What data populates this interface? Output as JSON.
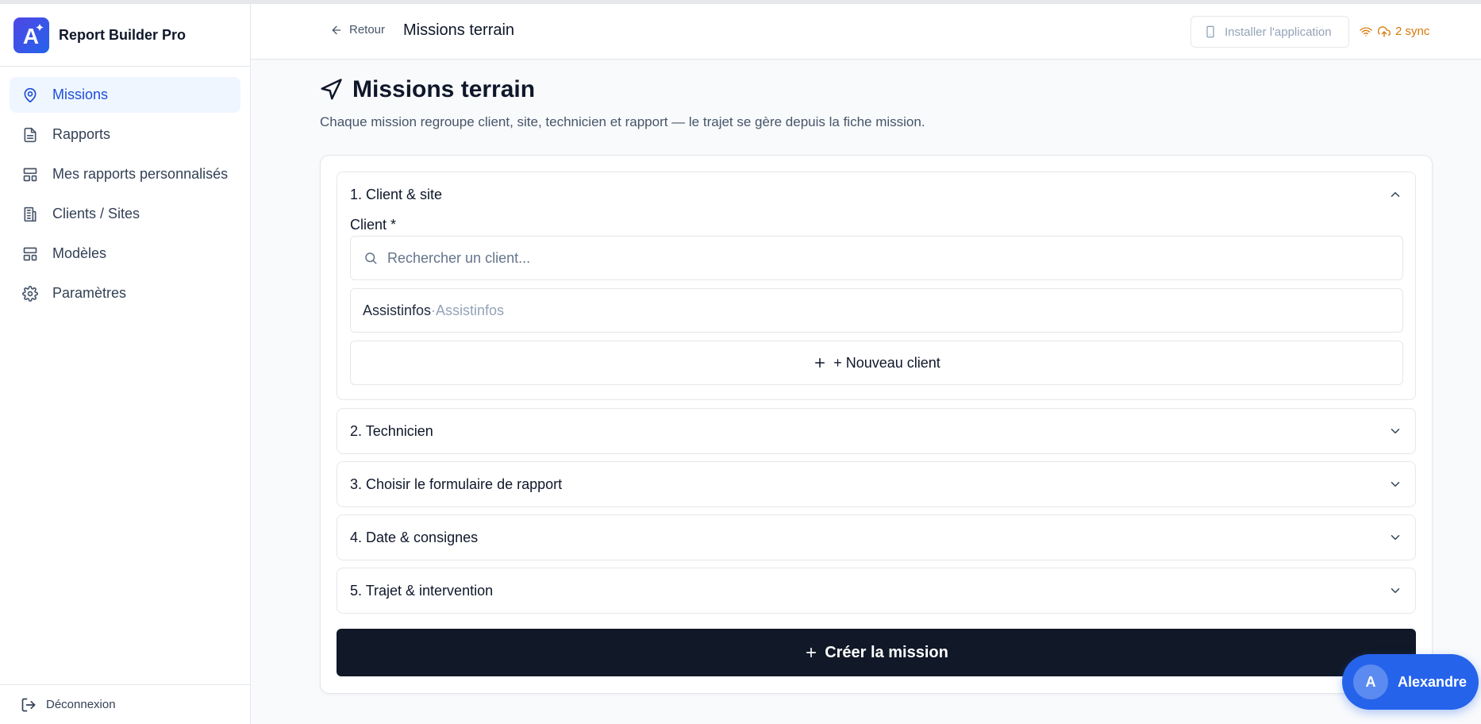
{
  "app": {
    "name": "Report Builder Pro",
    "logo_letter": "A"
  },
  "sidebar": {
    "items": [
      {
        "label": "Missions",
        "icon": "map-pin-icon",
        "active": true
      },
      {
        "label": "Rapports",
        "icon": "file-text-icon",
        "active": false
      },
      {
        "label": "Mes rapports personnalisés",
        "icon": "layout-icon",
        "active": false
      },
      {
        "label": "Clients / Sites",
        "icon": "building-icon",
        "active": false
      },
      {
        "label": "Modèles",
        "icon": "template-icon",
        "active": false
      },
      {
        "label": "Paramètres",
        "icon": "gear-icon",
        "active": false
      }
    ],
    "logout_label": "Déconnexion"
  },
  "header": {
    "back_label": "Retour",
    "title": "Missions terrain",
    "install_label": "Installer l'application",
    "sync_label": "2 sync",
    "sync_color": "#d97706"
  },
  "main": {
    "title": "Missions terrain",
    "subtitle": "Chaque mission regroupe client, site, technicien et rapport — le trajet se gère depuis la fiche mission.",
    "sections": [
      {
        "label": "1. Client & site",
        "expanded": true
      },
      {
        "label": "2. Technicien",
        "expanded": false
      },
      {
        "label": "3. Choisir le formulaire de rapport",
        "expanded": false
      },
      {
        "label": "4. Date & consignes",
        "expanded": false
      },
      {
        "label": "5. Trajet & intervention",
        "expanded": false
      }
    ],
    "client_field": {
      "label": "Client *",
      "placeholder": "Rechercher un client...",
      "value": ""
    },
    "client_option": {
      "name": "Assistinfos",
      "separator": " · ",
      "site": "Assistinfos"
    },
    "new_client_label": "+ Nouveau client",
    "create_label": "Créer la mission",
    "accent_color": "#1d4ed8",
    "primary_button_color": "#111827"
  },
  "user": {
    "initial": "A",
    "name": "Alexandre"
  }
}
